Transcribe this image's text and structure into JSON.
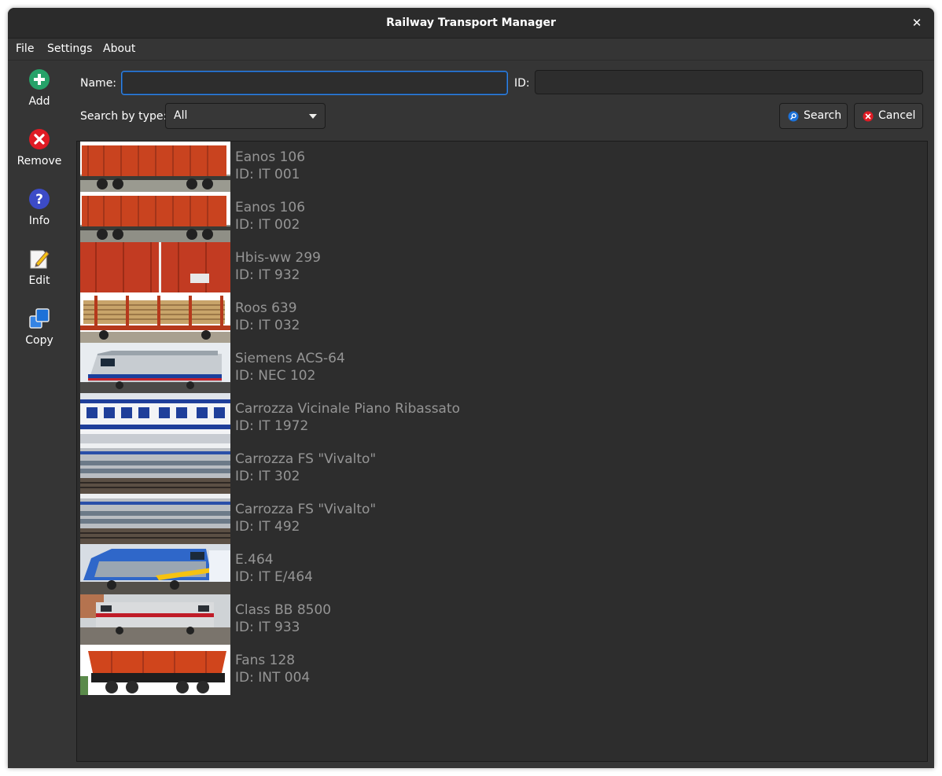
{
  "window": {
    "title": "Railway Transport Manager",
    "close_glyph": "✕"
  },
  "menu": [
    "File",
    "Settings",
    "About"
  ],
  "toolbar": [
    {
      "label": "Add",
      "icon": "add-icon"
    },
    {
      "label": "Remove",
      "icon": "remove-icon"
    },
    {
      "label": "Info",
      "icon": "info-icon"
    },
    {
      "label": "Edit",
      "icon": "edit-icon"
    },
    {
      "label": "Copy",
      "icon": "copy-icon"
    }
  ],
  "search": {
    "name_label": "Name:",
    "name_value": "",
    "id_label": "ID:",
    "id_value": "",
    "type_label": "Search by type:",
    "type_value": "All",
    "search_label": "Search",
    "cancel_label": "Cancel"
  },
  "vehicles": [
    {
      "name": "Eanos 106",
      "id": "ID: IT 001",
      "thumb": "freight-wagon-red"
    },
    {
      "name": "Eanos 106",
      "id": "ID: IT 002",
      "thumb": "freight-wagon-red"
    },
    {
      "name": "Hbis-ww 299",
      "id": "ID: IT 932",
      "thumb": "covered-wagon-red"
    },
    {
      "name": "Roos 639",
      "id": "ID: IT 032",
      "thumb": "log-wagon"
    },
    {
      "name": "Siemens ACS-64",
      "id": "ID: NEC 102",
      "thumb": "locomotive-silver"
    },
    {
      "name": "Carrozza Vicinale Piano Ribassato",
      "id": "ID: IT 1972",
      "thumb": "coach-white-blue"
    },
    {
      "name": "Carrozza FS \"Vivalto\"",
      "id": "ID: IT 302",
      "thumb": "double-deck-coach"
    },
    {
      "name": "Carrozza FS \"Vivalto\"",
      "id": "ID: IT 492",
      "thumb": "double-deck-coach"
    },
    {
      "name": "E.464",
      "id": "ID: IT E/464",
      "thumb": "locomotive-blue"
    },
    {
      "name": "Class BB 8500",
      "id": "ID: IT 933",
      "thumb": "locomotive-grey-red"
    },
    {
      "name": "Fans 128",
      "id": "ID: INT 004",
      "thumb": "hopper-wagon-red"
    }
  ],
  "colors": {
    "window_bg": "#353535",
    "accent": "#3584e4",
    "add": "#26a269",
    "remove": "#e01b24",
    "info": "#3c4bc7",
    "row_text": "#959595"
  }
}
